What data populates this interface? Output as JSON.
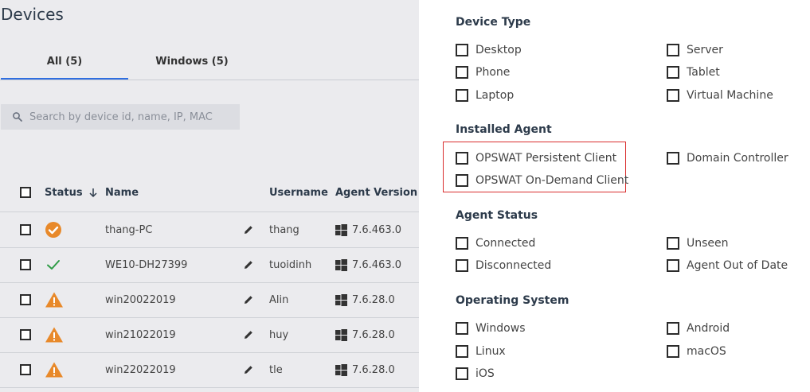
{
  "page": {
    "title": "Devices"
  },
  "tabs": [
    {
      "label": "All (5)"
    },
    {
      "label": "Windows (5)"
    }
  ],
  "search": {
    "placeholder": "Search by device id, name, IP, MAC"
  },
  "table": {
    "headers": {
      "status": "Status",
      "name": "Name",
      "username": "Username",
      "agent_version": "Agent Version"
    },
    "rows": [
      {
        "status": "ok-circle",
        "name": "thang-PC",
        "username": "thang",
        "agent_version": "7.6.463.0"
      },
      {
        "status": "check",
        "name": "WE10-DH27399",
        "username": "tuoidinh",
        "agent_version": "7.6.463.0"
      },
      {
        "status": "warning",
        "name": "win20022019",
        "username": "Alin",
        "agent_version": "7.6.28.0"
      },
      {
        "status": "warning",
        "name": "win21022019",
        "username": "huy",
        "agent_version": "7.6.28.0"
      },
      {
        "status": "warning",
        "name": "win22022019",
        "username": "tle",
        "agent_version": "7.6.28.0"
      }
    ]
  },
  "filters": {
    "device_type": {
      "title": "Device Type",
      "options": [
        "Desktop",
        "Phone",
        "Laptop",
        "Server",
        "Tablet",
        "Virtual Machine"
      ]
    },
    "installed_agent": {
      "title": "Installed Agent",
      "options": [
        "OPSWAT Persistent Client",
        "OPSWAT On-Demand Client",
        "Domain Controller"
      ]
    },
    "agent_status": {
      "title": "Agent Status",
      "options": [
        "Connected",
        "Disconnected",
        "Unseen",
        "Agent Out of Date"
      ]
    },
    "operating_system": {
      "title": "Operating System",
      "options": [
        "Windows",
        "Linux",
        "iOS",
        "Android",
        "macOS"
      ]
    }
  },
  "colors": {
    "accent": "#2f6ee0",
    "status_ok": "#e8892a",
    "status_check": "#2e9c46",
    "status_warning": "#e8892a",
    "highlight_border": "#d92e2e"
  }
}
